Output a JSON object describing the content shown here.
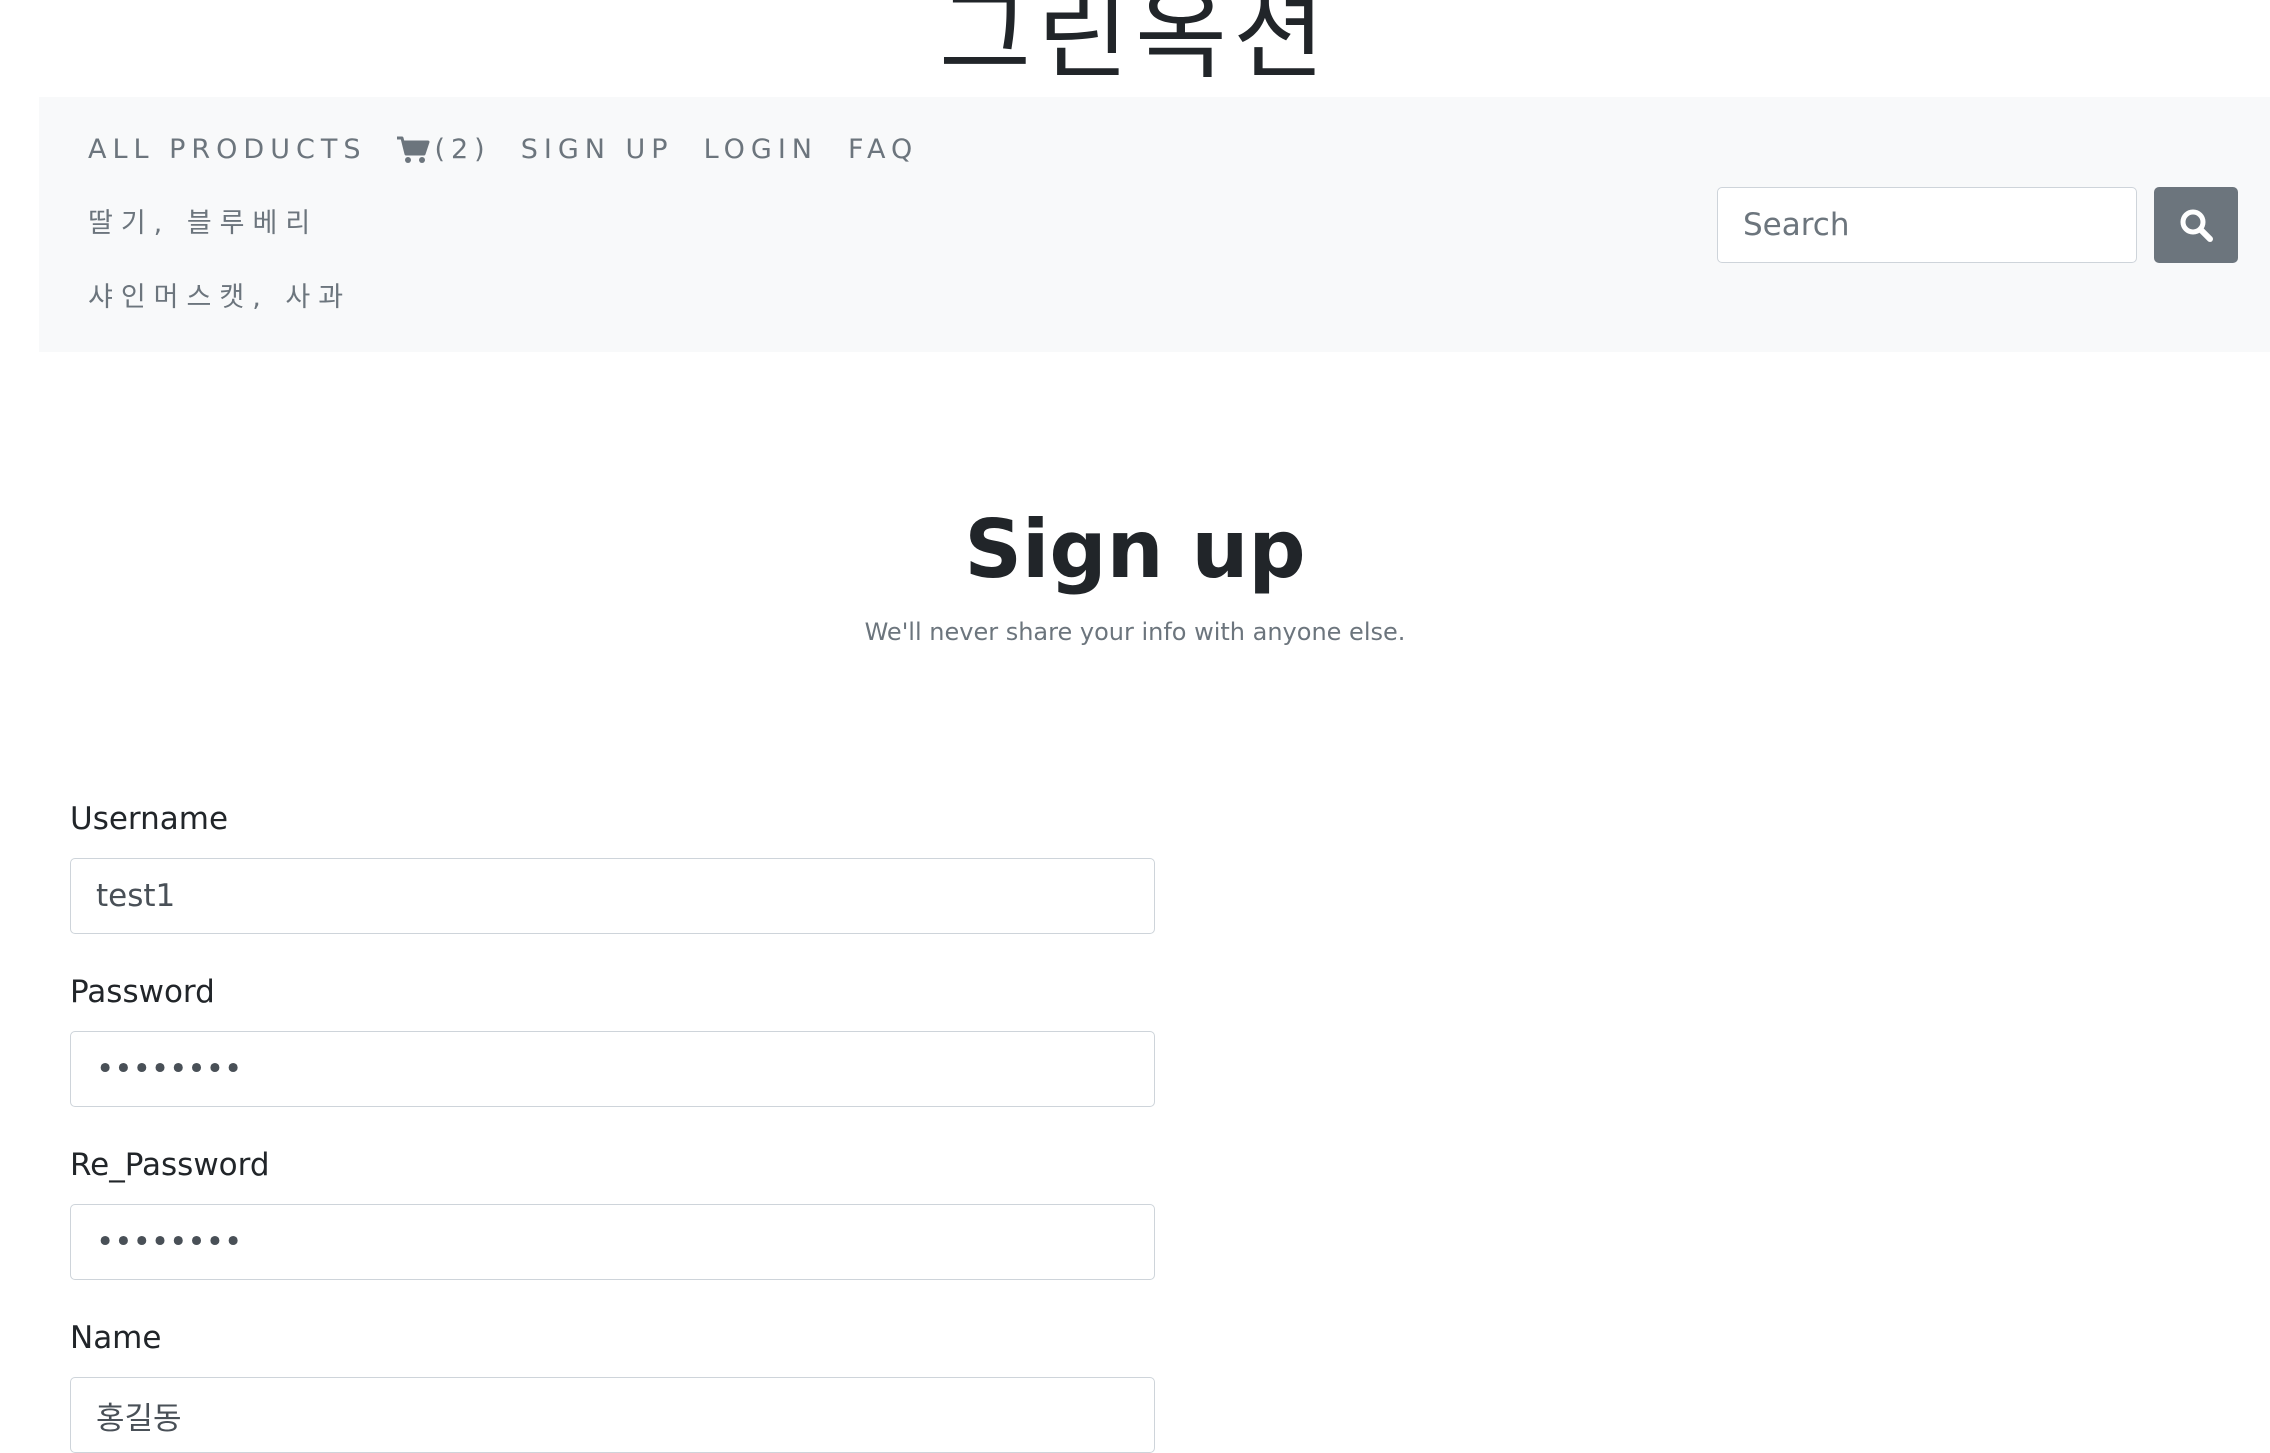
{
  "brand": {
    "title": "그린옥션"
  },
  "nav": {
    "all_products": "ALL PRODUCTS",
    "cart_count": "(2)",
    "sign_up": "SIGN UP",
    "login": "LOGIN",
    "faq": "FAQ",
    "category_1": "딸기, 블루베리",
    "category_2": "샤인머스캣, 사과"
  },
  "search": {
    "placeholder": "Search",
    "icon": "search-icon"
  },
  "page": {
    "title": "Sign up",
    "subtitle": "We'll never share your info with anyone else."
  },
  "form": {
    "username_label": "Username",
    "username_value": "test1",
    "password_label": "Password",
    "password_value": "password",
    "repassword_label": "Re_Password",
    "repassword_value": "password",
    "name_label": "Name",
    "name_value": "홍길동"
  },
  "colors": {
    "navbar_bg": "#f8f9fa",
    "nav_text": "#6c757d",
    "search_button": "#6c757d",
    "heading": "#212529"
  }
}
